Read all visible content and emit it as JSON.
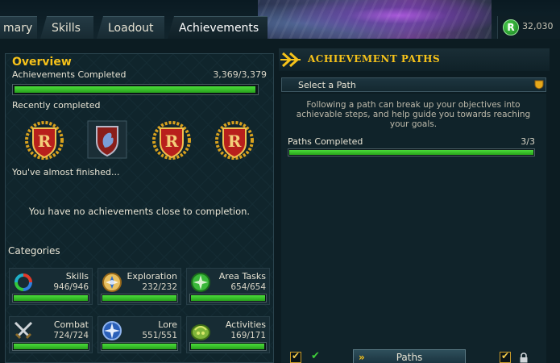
{
  "header": {
    "tabs": [
      {
        "label": "mary"
      },
      {
        "label": "Skills"
      },
      {
        "label": "Loadout"
      },
      {
        "label": "Achievements"
      }
    ],
    "coins": {
      "amount": "32,030",
      "icon": "runecoin-icon"
    }
  },
  "overview": {
    "title": "Overview",
    "achievements_label": "Achievements Completed",
    "achievements_count": "3,369/3,379",
    "achievements_progress": 0.997,
    "recently_completed_label": "Recently completed",
    "recent_badges": [
      "r-shield-badge",
      "dragon-shield-badge",
      "r-shield-badge",
      "r-shield-badge"
    ],
    "almost_finished_label": "You've almost finished...",
    "no_close_message": "You have no achievements close to completion."
  },
  "categories": {
    "title": "Categories",
    "items": [
      {
        "name": "Skills",
        "count": "946/946",
        "progress": 1.0,
        "icon": "skills-ring-icon"
      },
      {
        "name": "Exploration",
        "count": "232/232",
        "progress": 1.0,
        "icon": "compass-icon"
      },
      {
        "name": "Area Tasks",
        "count": "654/654",
        "progress": 1.0,
        "icon": "area-tasks-icon"
      },
      {
        "name": "Combat",
        "count": "724/724",
        "progress": 1.0,
        "icon": "crossed-swords-icon"
      },
      {
        "name": "Lore",
        "count": "551/551",
        "progress": 1.0,
        "icon": "lore-star-icon"
      },
      {
        "name": "Activities",
        "count": "169/171",
        "progress": 0.988,
        "icon": "activities-icon"
      }
    ]
  },
  "paths": {
    "title": "ACHIEVEMENT PATHS",
    "select_label": "Select a Path",
    "description": "Following a path can break up your objectives into achievable steps, and help guide you towards reaching your goals.",
    "completed_label": "Paths Completed",
    "completed_count": "3/3",
    "completed_progress": 1.0,
    "button_label": "Paths"
  },
  "colors": {
    "accent_gold": "#f6c21a",
    "progress_green": "#36c228",
    "panel_bg": "#10252c"
  }
}
